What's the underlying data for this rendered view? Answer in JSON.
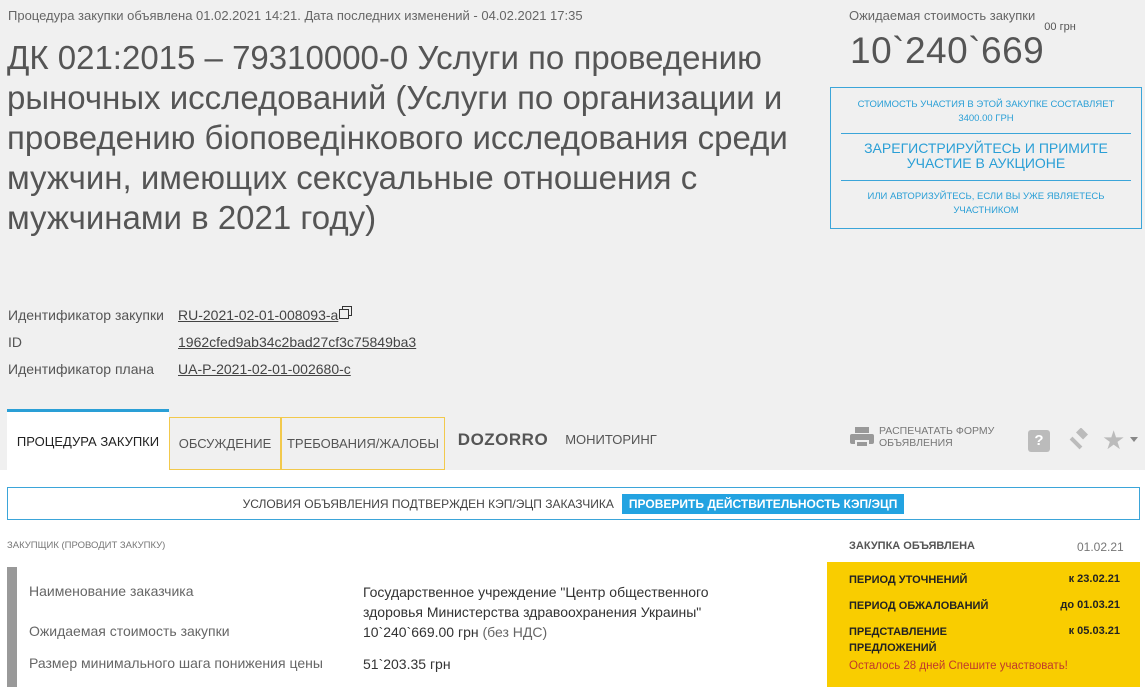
{
  "header": {
    "meta_line": "Процедура закупки объявлена 01.02.2021 14:21. Дата последних изменений - 04.02.2021 17:35",
    "title": "ДК 021:2015 – 79310000-0 Услуги по проведению рыночных исследований (Услуги по организации и проведению біоповедінкового исследования среди мужчин, имеющих сексуальные отношения с мужчинами в 2021 году)"
  },
  "identifiers": [
    {
      "label": "Идентификатор закупки",
      "value": "RU-2021-02-01-008093-a"
    },
    {
      "label": "ID",
      "value": "1962cfed9ab34c2bad27cf3c75849ba3"
    },
    {
      "label": "Идентификатор плана",
      "value": "UA-P-2021-02-01-002680-c"
    }
  ],
  "cost": {
    "label": "Ожидаемая стоимость закупки",
    "value": "10`240`669",
    "cents": "00",
    "currency": "грн"
  },
  "registration": {
    "participation_text": "СТОИМОСТЬ УЧАСТИЯ В ЭТОЙ ЗАКУПКЕ СОСТАВЛЯЕТ 3400.00 ГРН",
    "register_text": "ЗАРЕГИСТРИРУЙТЕСЬ И ПРИМИТЕ УЧАСТИЕ В АУКЦИОНЕ",
    "login_text": "ИЛИ АВТОРИЗУЙТЕСЬ, ЕСЛИ ВЫ УЖЕ ЯВЛЯЕТЕСЬ УЧАСТНИКОМ"
  },
  "tabs": [
    {
      "label": "ПРОЦЕДУРА ЗАКУПКИ"
    },
    {
      "label": "ОБСУЖДЕНИЕ"
    },
    {
      "label": "ТРЕБОВАНИЯ/ЖАЛОБЫ"
    },
    {
      "label": "DOZORRO"
    },
    {
      "label": "МОНИТОРИНГ"
    }
  ],
  "toolbar": {
    "print_label": "РАСПЕЧАТАТЬ ФОРМУ ОБЪЯВЛЕНИЯ",
    "help_glyph": "?",
    "star_glyph": "★"
  },
  "kep": {
    "text": "УСЛОВИЯ ОБЪЯВЛЕНИЯ ПОДТВЕРЖДЕН КЭП/ЭЦП ЗАКАЗЧИКА",
    "button": "ПРОВЕРИТЬ ДЕЙСТВИТЕЛЬНОСТЬ КЭП/ЭЦП"
  },
  "customer": {
    "section_label": "ЗАКУПЩИК (ПРОВОДИТ ЗАКУПКУ)",
    "rows": [
      {
        "label": "Наименование заказчика",
        "value": "Государственное учреждение \"Центр общественного здоровья Министерства здравоохранения Украины\"",
        "extra": ""
      },
      {
        "label": "Ожидаемая стоимость закупки",
        "value": "10`240`669.00 грн",
        "extra": "(без НДС)"
      },
      {
        "label": "Размер минимального шага понижения цены",
        "value": "51`203.35 грн",
        "extra": ""
      }
    ]
  },
  "status": {
    "announced_label": "ЗАКУПКА ОБЪЯВЛЕНА",
    "announced_date": "01.02.21",
    "periods": [
      {
        "label": "ПЕРИОД УТОЧНЕНИЙ",
        "value": "к 23.02.21"
      },
      {
        "label": "ПЕРИОД ОБЖАЛОВАНИЙ",
        "value": "до 01.03.21"
      },
      {
        "label": "ПРЕДСТАВЛЕНИЕ ПРЕДЛОЖЕНИЙ",
        "value": "к 05.03.21"
      }
    ],
    "remaining": "Осталось 28 дней Спешите участвовать!"
  },
  "colors": {
    "accent": "#2a9fd6",
    "highlight": "#f9cd00",
    "tab_outline": "#f2c94c",
    "warning_text": "#c0392b"
  }
}
